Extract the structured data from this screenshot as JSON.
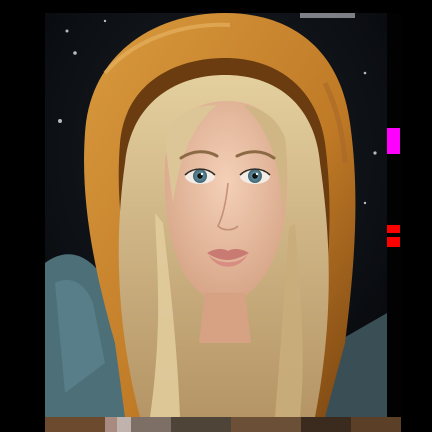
{
  "image": {
    "subject": "portrait-with-orange-hood",
    "colors": {
      "hood": "#c9862d",
      "hood_shadow": "#8a5417",
      "hair": "#d8c08f",
      "skin": "#e9bfa3",
      "eyes": "#5f8fa0",
      "lips": "#c97a72",
      "jacket": "#4d6f78",
      "background": "#0b0d10"
    }
  },
  "artifacts": {
    "glitch_colors": [
      "#ff00ff",
      "#ff0000",
      "#ff0000"
    ],
    "bottom_strip_colors": [
      "#6b4a2e",
      "#a98a80",
      "#c0b3ae",
      "#7e6f66",
      "#4e4438",
      "#6b4f37",
      "#3a2b1e",
      "#5b3f26"
    ]
  }
}
